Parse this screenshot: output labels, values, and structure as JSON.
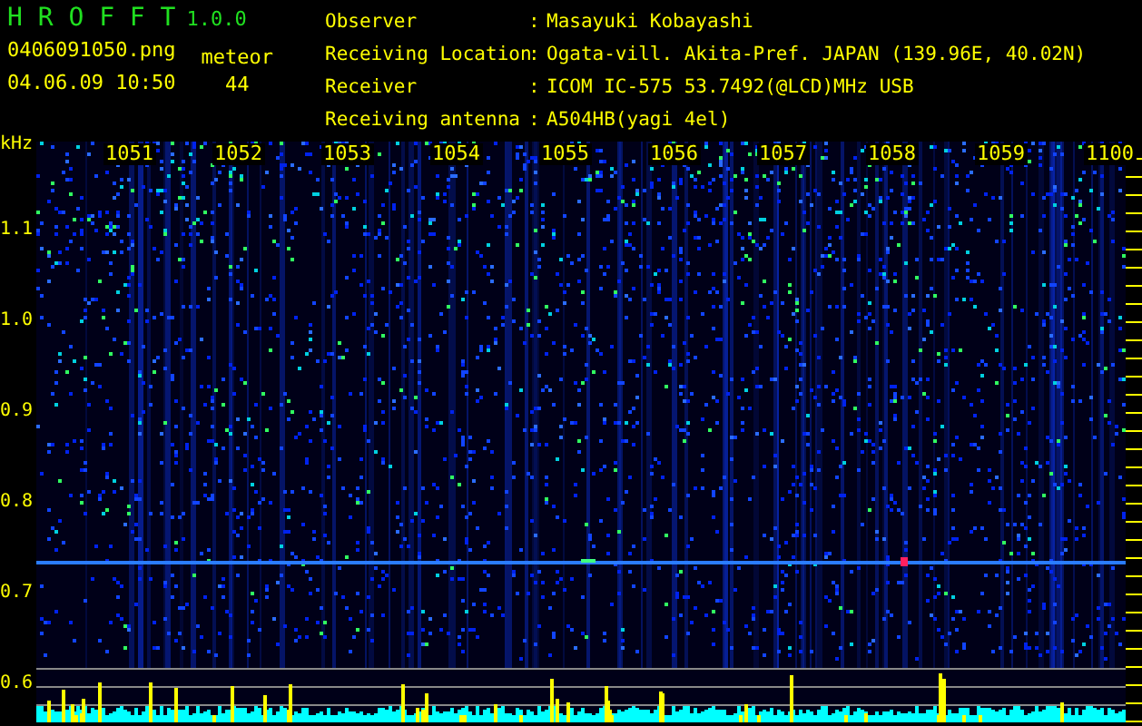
{
  "app": {
    "name": "H R O F F T",
    "version": "1.0.0"
  },
  "file": "0406091050.png",
  "timestamp": "04.06.09 10:50",
  "meteor": {
    "label": "meteor",
    "count": "44"
  },
  "info": [
    {
      "label": "Observer",
      "separator": ":",
      "value": "Masayuki Kobayashi"
    },
    {
      "label": "Receiving Location",
      "separator": ":",
      "value": "Ogata-vill. Akita-Pref. JAPAN (139.96E, 40.02N)"
    },
    {
      "label": "Receiver",
      "separator": ":",
      "value": "ICOM IC-575 53.7492(@LCD)MHz USB"
    },
    {
      "label": "Receiving antenna",
      "separator": ":",
      "value": "A504HB(yagi 4el)"
    }
  ],
  "spectrogram": {
    "unit": "kHz",
    "time_labels": [
      "1051",
      "1052",
      "1053",
      "1054",
      "1055",
      "1056",
      "1057",
      "1058",
      "1059",
      "1100"
    ],
    "freq_labels": [
      "1.1",
      "1.0",
      "0.9",
      "0.8",
      "0.7",
      "0.6"
    ]
  }
}
